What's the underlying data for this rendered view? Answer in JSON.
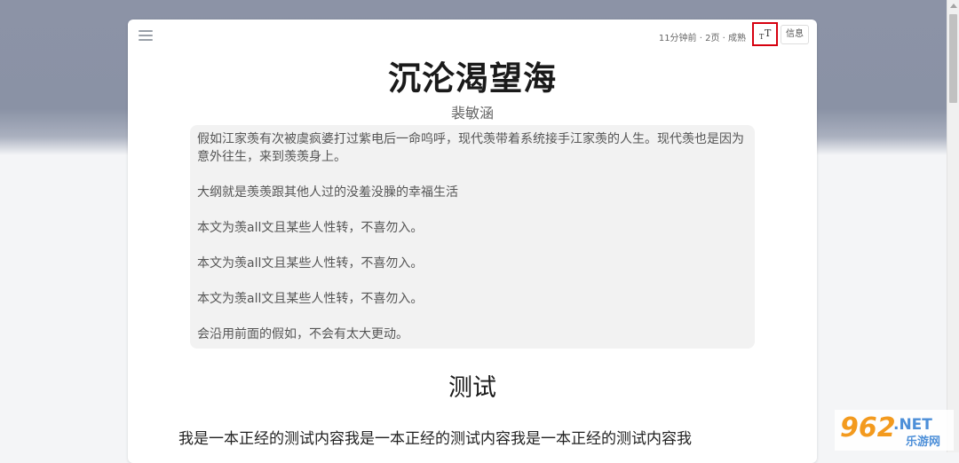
{
  "header": {
    "meta": "11分钟前 · 2页 · 成熟",
    "fontsize_icon_big": "T",
    "fontsize_icon_small": "T",
    "info_label": "信息"
  },
  "book": {
    "title": "沉沦渴望海",
    "author": "裴敏涵",
    "summary": [
      "假如江家羡有次被虞疯婆打过紫电后一命呜呼，现代羡带着系统接手江家羡的人生。现代羡也是因为意外往生，来到羡羡身上。",
      "大纲就是羡羡跟其他人过的没羞没臊的幸福生活",
      "本文为羡all文且某些人性转，不喜勿入。",
      "本文为羡all文且某些人性转，不喜勿入。",
      "本文为羡all文且某些人性转，不喜勿入。",
      "会沿用前面的假如，不会有太大更动。"
    ]
  },
  "chapter": {
    "title": "测试",
    "body": "我是一本正经的测试内容我是一本正经的测试内容我是一本正经的测试内容我"
  },
  "watermark": {
    "text_big": "962",
    "text_net": ".NET",
    "text_sub": "乐游网"
  },
  "colors": {
    "highlight_border": "#d6000f",
    "band": "#8a92a5",
    "watermark_orange": "#f39a1e"
  }
}
